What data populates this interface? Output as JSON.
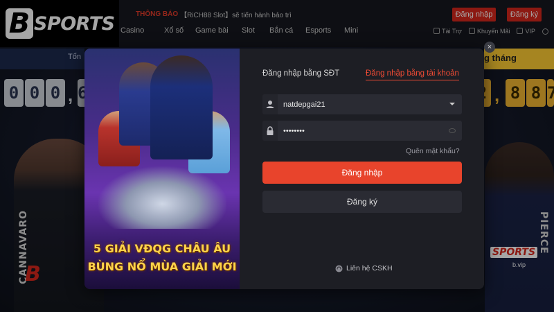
{
  "header": {
    "logo_text": "SPORTS",
    "logo_letter": "B",
    "notice_tag": "THÔNG BÁO",
    "notice_text": "【RiCH88 Slot】sẽ tiến hành bảo trì v",
    "login_label": "Đăng nhập",
    "register_label": "Đăng ký",
    "nav": [
      "Casino",
      "Xổ số",
      "Game bài",
      "Slot",
      "Bắn cá",
      "Esports",
      "Mini"
    ],
    "util": [
      "Tài Trợ",
      "Khuyến Mãi",
      "VIP"
    ],
    "accent": "#d7271d"
  },
  "hero": {
    "left_label": "Tổn",
    "right_label": "g tháng",
    "left_digits": [
      "0",
      "0",
      "0"
    ],
    "left_partial": "6",
    "right_partial": "2",
    "right_digits": [
      "8",
      "8",
      "7"
    ],
    "name_left": "CANNAVARO",
    "name_right": "PIERCE",
    "shirt_sub_right": "b.vip"
  },
  "modal": {
    "close_glyph": "×",
    "promo_title_line1": "5 GIẢI VĐQG CHÂU ÂU",
    "promo_title_line2": "BÙNG NỔ MÙA GIẢI MỚI",
    "tab_phone": "Đăng nhập bằng SĐT",
    "tab_account": "Đăng nhập bằng tài khoản",
    "username": "natdepgai21",
    "password": "••••••••",
    "forgot": "Quên mật khẩu?",
    "login_button": "Đăng nhập",
    "register_button": "Đăng ký",
    "support": "Liên hệ CSKH",
    "login_button_color": "#e8442c"
  }
}
